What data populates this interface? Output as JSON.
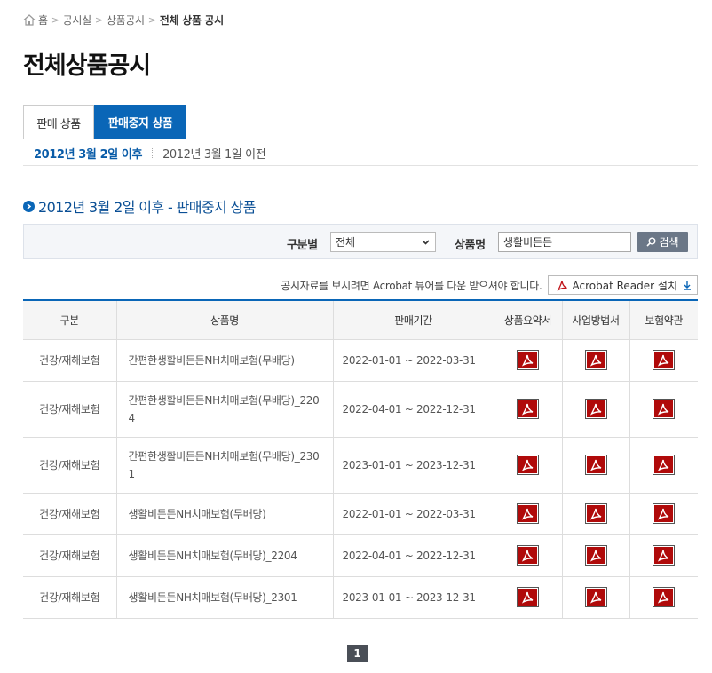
{
  "breadcrumb": {
    "items": [
      "홈",
      "공시실",
      "상품공시",
      "전체 상품 공시"
    ]
  },
  "page_title": "전체상품공시",
  "tabs": [
    {
      "label": "판매 상품",
      "active": false
    },
    {
      "label": "판매중지 상품",
      "active": true
    }
  ],
  "subtabs": [
    {
      "label": "2012년 3월 2일 이후",
      "active": true
    },
    {
      "label": "2012년 3월 1일 이전",
      "active": false
    }
  ],
  "section_title": "2012년 3월 2일 이후 - 판매중지 상품",
  "search": {
    "category_label": "구분별",
    "category_value": "전체",
    "product_label": "상품명",
    "product_value": "생활비든든",
    "button_label": "검색"
  },
  "acrobat": {
    "note": "공시자료를 보시려면 Acrobat 뷰어를 다운 받으셔야 합니다.",
    "button_label": "Acrobat Reader 설치"
  },
  "table": {
    "headers": [
      "구분",
      "상품명",
      "판매기간",
      "상품요약서",
      "사업방법서",
      "보험약관"
    ],
    "rows": [
      {
        "category": "건강/재해보험",
        "name": "간편한생활비든든NH치매보험(무배당)",
        "period": "2022-01-01 ~ 2022-03-31"
      },
      {
        "category": "건강/재해보험",
        "name": "간편한생활비든든NH치매보험(무배당)_2204",
        "period": "2022-04-01 ~ 2022-12-31"
      },
      {
        "category": "건강/재해보험",
        "name": "간편한생활비든든NH치매보험(무배당)_2301",
        "period": "2023-01-01 ~ 2023-12-31"
      },
      {
        "category": "건강/재해보험",
        "name": "생활비든든NH치매보험(무배당)",
        "period": "2022-01-01 ~ 2022-03-31"
      },
      {
        "category": "건강/재해보험",
        "name": "생활비든든NH치매보험(무배당)_2204",
        "period": "2022-04-01 ~ 2022-12-31"
      },
      {
        "category": "건강/재해보험",
        "name": "생활비든든NH치매보험(무배당)_2301",
        "period": "2023-01-01 ~ 2023-12-31"
      }
    ]
  },
  "pagination": {
    "current": "1"
  },
  "colors": {
    "accent": "#0a66b7",
    "pdf_red": "#b00a0a",
    "search_button": "#6b7787"
  },
  "icons": [
    "home-icon",
    "chevron-right-icon",
    "bullet-arrow-icon",
    "chevron-down-icon",
    "search-icon",
    "acrobat-icon",
    "download-icon",
    "pdf-icon"
  ]
}
